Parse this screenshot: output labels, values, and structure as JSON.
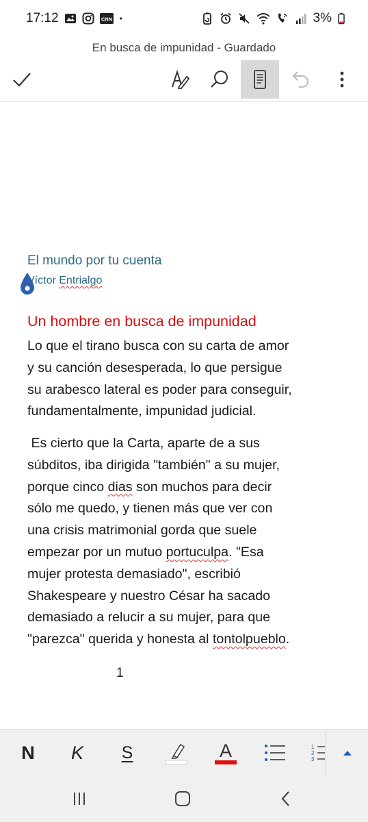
{
  "status_bar": {
    "time": "17:12",
    "left_icons": [
      "image-icon",
      "instagram-icon",
      "cnn-icon",
      "dot-icon"
    ],
    "right_icons": [
      "battery-saver-icon",
      "alarm-icon",
      "mute-icon",
      "wifi-icon",
      "wifi-call-icon",
      "signal-icon",
      "battery-icon"
    ],
    "battery_percent": "3%",
    "cnn_label": "CNN"
  },
  "header": {
    "title": "En busca de impunidad - Guardado"
  },
  "toolbar": {
    "items": [
      "done-check-icon",
      "draw-pen-icon",
      "search-icon",
      "mobile-view-icon",
      "undo-icon",
      "more-options-icon"
    ],
    "active": "mobile-view-icon"
  },
  "document": {
    "heading": "El mundo por tu cuenta",
    "author_first": "Víctor",
    "author_last": "Entrialgo",
    "subtitle": "Un hombre en busca de impunidad",
    "para1": {
      "l1": "Lo que el tirano busca con su carta de amor",
      "l2": "y su canción desesperada, lo que persigue",
      "l3": "su arabesco lateral es poder para conseguir,",
      "l4": "fundamentalmente, impunidad judicial."
    },
    "para2": {
      "l1": " Es cierto que la Carta, aparte de a sus",
      "l2": "súbditos, iba dirigida \"también\" a su mujer,",
      "l3a": "porque cinco ",
      "l3b": "dias",
      "l3c": " son muchos para decir",
      "l4": "sólo me quedo, y tienen más que ver con",
      "l5": "una crisis matrimonial gorda que suele",
      "l6a": "empezar por un mutuo ",
      "l6b": "portuculpa",
      "l6c": ". \"Esa",
      "l7": "mujer protesta demasiado\", escribió",
      "l8": "Shakespeare y nuestro César ha sacado",
      "l9": "demasiado a relucir a su mujer, para que",
      "l10a": "\"parezca\" querida y honesta al ",
      "l10b": "tontolpueblo",
      "l10c": "."
    },
    "page_number": "1"
  },
  "format_bar": {
    "bold": "N",
    "italic": "K",
    "underline": "S",
    "font_color_label": "A",
    "font_color": "#e01010",
    "highlight_color": "#ffffff",
    "list_numbers": [
      "1",
      "2",
      "3"
    ],
    "accent": "#1f5fa8"
  },
  "nav_bar": {
    "items": [
      "recent-apps-icon",
      "home-icon",
      "back-icon"
    ]
  }
}
